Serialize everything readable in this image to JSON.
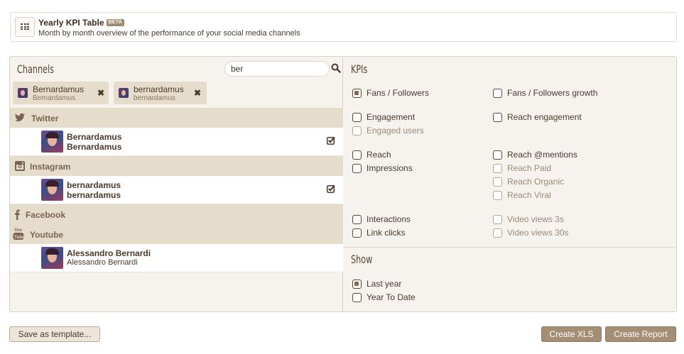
{
  "header": {
    "title": "Yearly KPI Table",
    "beta": "BETA",
    "subtitle": "Month by month overview of the performance of your social media channels",
    "icon": "grid-icon"
  },
  "channels": {
    "title": "Channels",
    "search_value": "ber",
    "search_icon": "search-icon",
    "selected_tags": [
      {
        "name": "Bernardamus",
        "handle": "Bernardamus"
      },
      {
        "name": "bernardamus",
        "handle": "bernardamus"
      }
    ],
    "networks": [
      {
        "name": "Twitter",
        "icon": "twitter-icon",
        "accounts": [
          {
            "name": "Bernardamus",
            "handle": "Bernardamus",
            "checked": true
          }
        ]
      },
      {
        "name": "Instagram",
        "icon": "instagram-icon",
        "accounts": [
          {
            "name": "bernardamus",
            "handle": "bernardamus",
            "checked": true
          }
        ]
      },
      {
        "name": "Facebook",
        "icon": "facebook-icon",
        "accounts": []
      },
      {
        "name": "Youtube",
        "icon": "youtube-icon",
        "accounts": [
          {
            "name": "Alessandro Bernardi",
            "handle": "Alessandro Bernardi",
            "checked": false
          }
        ]
      }
    ]
  },
  "kpis": {
    "title": "KPIs",
    "items": [
      {
        "label": "Fans / Followers",
        "checked": true,
        "disabled": false
      },
      {
        "label": "Fans / Followers growth",
        "checked": false,
        "disabled": false
      },
      {
        "label": "Engagement",
        "checked": false,
        "disabled": false
      },
      {
        "label": "Reach engagement",
        "checked": false,
        "disabled": false
      },
      {
        "label": "Engaged users",
        "checked": false,
        "disabled": true
      },
      {
        "label": "Reach",
        "checked": false,
        "disabled": false
      },
      {
        "label": "Reach @mentions",
        "checked": false,
        "disabled": false
      },
      {
        "label": "Impressions",
        "checked": false,
        "disabled": false
      },
      {
        "label": "Reach Paid",
        "checked": false,
        "disabled": true
      },
      {
        "label": "Reach Organic",
        "checked": false,
        "disabled": true
      },
      {
        "label": "Reach Viral",
        "checked": false,
        "disabled": true
      },
      {
        "label": "Interactions",
        "checked": false,
        "disabled": false
      },
      {
        "label": "Video views 3s",
        "checked": false,
        "disabled": true
      },
      {
        "label": "Link clicks",
        "checked": false,
        "disabled": false
      },
      {
        "label": "Video views 30s",
        "checked": false,
        "disabled": true
      }
    ]
  },
  "show": {
    "title": "Show",
    "options": [
      {
        "label": "Last year",
        "checked": true
      },
      {
        "label": "Year To Date",
        "checked": false
      }
    ]
  },
  "buttons": {
    "save_template": "Save as template...",
    "create_xls": "Create XLS",
    "create_report": "Create Report"
  },
  "colors": {
    "accent": "#a58e76",
    "row_header": "#e6dccc",
    "panel": "#f6f3ee"
  }
}
